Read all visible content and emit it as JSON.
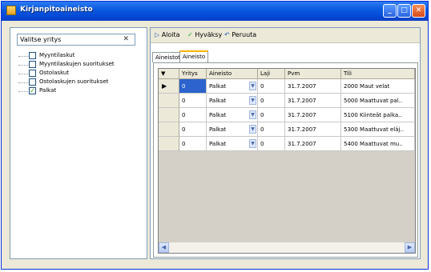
{
  "window": {
    "title": "Kirjanpitoaineisto"
  },
  "left": {
    "company_select": {
      "value": "Valitse yritys"
    },
    "tree_items": [
      {
        "label": "Myyntilaskut",
        "checked": false
      },
      {
        "label": "Myyntilaskujen suoritukset",
        "checked": false
      },
      {
        "label": "Ostolaskut",
        "checked": false
      },
      {
        "label": "Ostolaskujen suoritukset",
        "checked": false
      },
      {
        "label": "Palkat",
        "checked": true
      }
    ]
  },
  "toolbar": {
    "start": "Aloita",
    "approve": "Hyväksy",
    "cancel": "Peruuta"
  },
  "tabs": [
    {
      "label": "Aineistot"
    },
    {
      "label": "Aineisto"
    }
  ],
  "grid": {
    "columns": [
      "Yritys",
      "Aineisto",
      "Laji",
      "Pvm",
      "Tili"
    ],
    "rows": [
      {
        "yritys": "0",
        "aineisto": "Palkat",
        "laji": "0",
        "pvm": "31.7.2007",
        "tili": "2000 Maut velat"
      },
      {
        "yritys": "0",
        "aineisto": "Palkat",
        "laji": "0",
        "pvm": "31.7.2007",
        "tili": "5000 Maattuvat pal.."
      },
      {
        "yritys": "0",
        "aineisto": "Palkat",
        "laji": "0",
        "pvm": "31.7.2007",
        "tili": "5100 Kiinteät palka.."
      },
      {
        "yritys": "0",
        "aineisto": "Palkat",
        "laji": "0",
        "pvm": "31.7.2007",
        "tili": "5300 Maattuvat eläj.."
      },
      {
        "yritys": "0",
        "aineisto": "Palkat",
        "laji": "0",
        "pvm": "31.7.2007",
        "tili": "5400 Maattuvat mu.."
      }
    ]
  },
  "colors": {
    "titlebar": "#0a5be0",
    "selection": "#2c63cc",
    "check": "#21a121"
  }
}
